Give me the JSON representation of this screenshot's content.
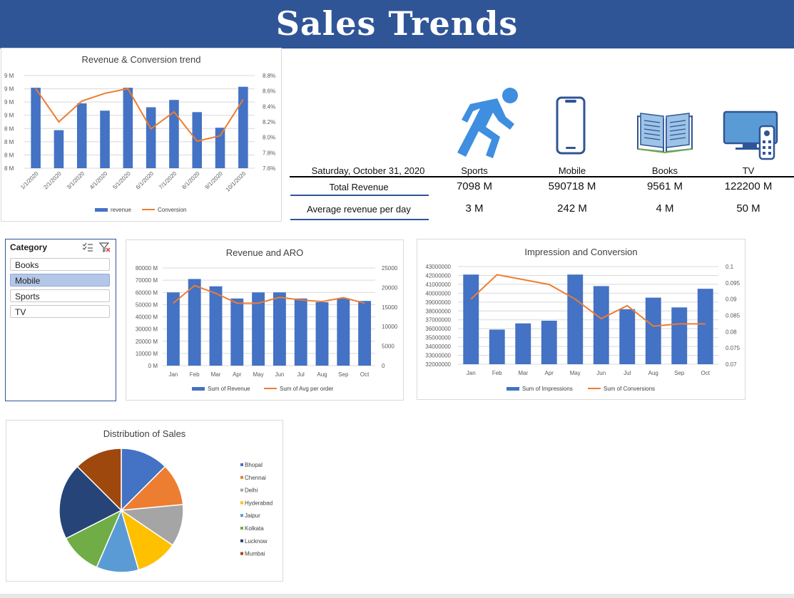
{
  "header": {
    "title": "Sales Trends"
  },
  "colors": {
    "header_bg": "#2f5597",
    "bar": "#4472c4",
    "line": "#ed7d31"
  },
  "kpi": {
    "date": "Saturday, October 31, 2020",
    "row1_label": "Total Revenue",
    "row2_label": "Average revenue per day",
    "categories": [
      {
        "name": "Sports",
        "icon": "runner-icon",
        "total": "7098 M",
        "avg": "3 M"
      },
      {
        "name": "Mobile",
        "icon": "smartphone-icon",
        "total": "590718 M",
        "avg": "242 M"
      },
      {
        "name": "Books",
        "icon": "open-book-icon",
        "total": "9561 M",
        "avg": "4 M"
      },
      {
        "name": "TV",
        "icon": "tv-remote-icon",
        "total": "122200 M",
        "avg": "50 M"
      }
    ]
  },
  "slicer": {
    "title": "Category",
    "items": [
      {
        "label": "Books",
        "selected": false
      },
      {
        "label": "Mobile",
        "selected": true
      },
      {
        "label": "Sports",
        "selected": false
      },
      {
        "label": "TV",
        "selected": false
      }
    ]
  },
  "chart_data": [
    {
      "id": "rev_conv",
      "type": "bar+line",
      "title": "Revenue & Conversion trend",
      "categories": [
        "1/1/2020",
        "2/1/2020",
        "3/1/2020",
        "4/1/2020",
        "5/1/2020",
        "6/1/2020",
        "7/1/2020",
        "8/1/2020",
        "9/1/2020",
        "10/1/2020"
      ],
      "series": [
        {
          "name": "revenue",
          "kind": "bar",
          "axis": "left",
          "values": [
            9.65,
            8.78,
            9.33,
            9.18,
            9.65,
            9.25,
            9.4,
            9.15,
            8.83,
            9.67
          ]
        },
        {
          "name": "Conversion",
          "kind": "line",
          "axis": "right",
          "values": [
            8.63,
            8.2,
            8.47,
            8.57,
            8.63,
            8.11,
            8.33,
            7.95,
            8.02,
            8.49
          ]
        }
      ],
      "y_left_ticks": [
        "9 M",
        "9 M",
        "9 M",
        "9 M",
        "8 M",
        "8 M",
        "8 M",
        "8 M"
      ],
      "y_left_range": [
        8.0,
        9.9
      ],
      "y_right_ticks": [
        "8.8%",
        "8.6%",
        "8.4%",
        "8.2%",
        "8.0%",
        "7.8%",
        "7.6%"
      ],
      "y_right_range": [
        7.6,
        8.8
      ],
      "legend": "bottom"
    },
    {
      "id": "rev_aro",
      "type": "bar+line",
      "title": "Revenue and ARO",
      "categories": [
        "Jan",
        "Feb",
        "Mar",
        "Apr",
        "May",
        "Jun",
        "Jul",
        "Aug",
        "Sep",
        "Oct"
      ],
      "series": [
        {
          "name": "Sum of Revenue",
          "kind": "bar",
          "axis": "left",
          "values": [
            60000,
            71000,
            65000,
            55000,
            60000,
            60000,
            55000,
            52000,
            55000,
            53000
          ]
        },
        {
          "name": "Sum of Avg per order",
          "kind": "line",
          "axis": "right",
          "values": [
            16000,
            20500,
            18500,
            16000,
            16000,
            17500,
            16800,
            16400,
            17400,
            16000
          ]
        }
      ],
      "y_left_ticks": [
        "80000 M",
        "70000 M",
        "60000 M",
        "50000 M",
        "40000 M",
        "30000 M",
        "20000 M",
        "10000 M",
        "0 M"
      ],
      "y_left_range": [
        0,
        80000
      ],
      "y_right_ticks": [
        "25000",
        "20000",
        "15000",
        "10000",
        "5000",
        "0"
      ],
      "y_right_range": [
        0,
        25000
      ],
      "legend": "bottom"
    },
    {
      "id": "imp_conv",
      "type": "bar+line",
      "title": "Impression and Conversion",
      "categories": [
        "Jan",
        "Feb",
        "Mar",
        "Apr",
        "May",
        "Jun",
        "Jul",
        "Aug",
        "Sep",
        "Oct"
      ],
      "series": [
        {
          "name": "Sum of Impressions",
          "kind": "bar",
          "axis": "left",
          "values": [
            42100000,
            35900000,
            36600000,
            36900000,
            42100000,
            40800000,
            38200000,
            39500000,
            38400000,
            40500000
          ]
        },
        {
          "name": "Sum of Conversions",
          "kind": "line",
          "axis": "right",
          "values": [
            0.09,
            0.0975,
            0.096,
            0.0945,
            0.09,
            0.084,
            0.088,
            0.0817,
            0.0824,
            0.0824
          ]
        }
      ],
      "y_left_ticks": [
        "43000000",
        "42000000",
        "41000000",
        "40000000",
        "39000000",
        "38000000",
        "37000000",
        "36000000",
        "35000000",
        "34000000",
        "33000000",
        "32000000"
      ],
      "y_left_range": [
        32000000,
        43000000
      ],
      "y_right_ticks": [
        "0.1",
        "0.095",
        "0.09",
        "0.085",
        "0.08",
        "0.075",
        "0.07"
      ],
      "y_right_range": [
        0.07,
        0.1
      ],
      "legend": "bottom"
    },
    {
      "id": "dist",
      "type": "pie",
      "title": "Distribution of Sales",
      "labels": [
        "Bhopal",
        "Chennai",
        "Delhi",
        "Hyderabad",
        "Jaipur",
        "Kolkata",
        "Lucknow",
        "Mumbai"
      ],
      "values": [
        12.5,
        11,
        11,
        11,
        11,
        11,
        20,
        12.5
      ],
      "colors": [
        "#4472c4",
        "#ed7d31",
        "#a5a5a5",
        "#ffc000",
        "#5b9bd5",
        "#70ad47",
        "#264478",
        "#9e480e"
      ],
      "legend": "right"
    }
  ]
}
